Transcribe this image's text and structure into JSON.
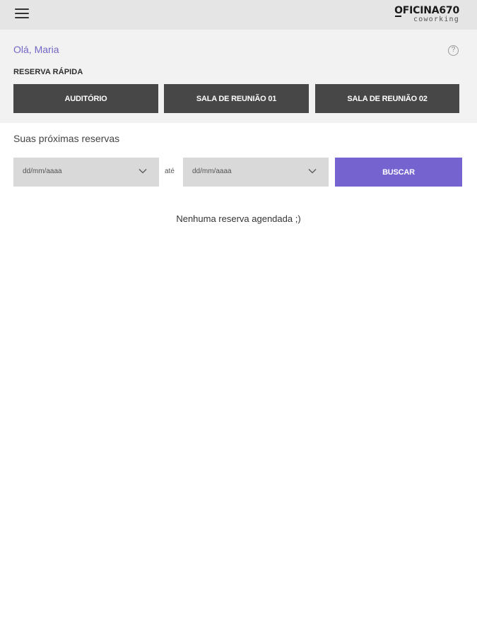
{
  "header": {
    "menu_icon": "hamburger-menu-icon",
    "logo_main": "OFICINA670",
    "logo_sub": "coworking"
  },
  "greeting": "Olá, Maria",
  "help_icon": {
    "name": "help-icon",
    "glyph": "?"
  },
  "quick_booking": {
    "title": "RESERVA RÁPIDA",
    "buttons": [
      {
        "label": "AUDITÓRIO"
      },
      {
        "label": "SALA DE REUNIÃO 01"
      },
      {
        "label": "SALA DE REUNIÃO 02"
      }
    ]
  },
  "reservations": {
    "title": "Suas próximas reservas",
    "from_placeholder": "dd/mm/aaaa",
    "separator": "até",
    "to_placeholder": "dd/mm/aaaa",
    "search_label": "BUSCAR",
    "empty_message": "Nenhuma reserva agendada ;)"
  },
  "colors": {
    "accent": "#7563d0",
    "greeting": "#7066c8",
    "dark_button": "#474747",
    "topbar": "#e5e5e5",
    "panel": "#f2f2f2",
    "field": "#d9d9d9"
  }
}
